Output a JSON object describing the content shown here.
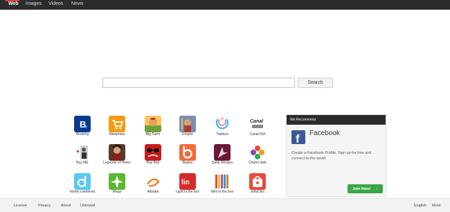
{
  "nav": {
    "tabs": [
      {
        "label": "Web",
        "active": true
      },
      {
        "label": "Images",
        "active": false
      },
      {
        "label": "Videos",
        "active": false
      },
      {
        "label": "News",
        "active": false
      }
    ],
    "accent_color": "#e53935"
  },
  "search": {
    "value": "",
    "button_label": "Search"
  },
  "tiles": [
    {
      "label": "Booking",
      "icon": "booking-icon"
    },
    {
      "label": "Aliexpress",
      "icon": "aliexpress-cart-icon"
    },
    {
      "label": "Big Farm",
      "icon": "big-farm-icon"
    },
    {
      "label": "Empire",
      "icon": "empire-icon"
    },
    {
      "label": "Topface",
      "icon": "topface-icon"
    },
    {
      "label": "Canal Flirt",
      "icon": "canal-flirt-icon",
      "icon_text": "Canal"
    },
    {
      "label": "Buy ME",
      "icon": "buyme-icon"
    },
    {
      "label": "Legends of Honor",
      "icon": "legends-of-honor-icon"
    },
    {
      "label": "Ray Ban",
      "icon": "ray-ban-icon"
    },
    {
      "label": "Badoo",
      "icon": "badoo-icon"
    },
    {
      "label": "Qatar Airways",
      "icon": "qatar-airways-icon"
    },
    {
      "label": "Charm date",
      "icon": "charm-date-icon"
    },
    {
      "label": "hotels combined",
      "icon": "hotels-combined-icon"
    },
    {
      "label": "Wego",
      "icon": "wego-plane-icon"
    },
    {
      "label": "Alibaba",
      "icon": "alibaba-icon"
    },
    {
      "label": "Light in the box",
      "icon": "light-in-the-box-icon",
      "icon_text": "lin"
    },
    {
      "label": "Mini in the box",
      "icon": "mini-in-the-box-icon"
    },
    {
      "label": "JollyChic",
      "icon": "jollychic-icon"
    }
  ],
  "recommend": {
    "header": "We Recommend",
    "title": "Facebook",
    "description": "Create a Facebook Profile. Sign up for free and connect to the world",
    "button_label": "Join Now!",
    "button_color": "#3aa745",
    "brand_color": "#3b5998"
  },
  "footer": {
    "links": [
      "License",
      "Privacy",
      "About",
      "Uninstall"
    ],
    "language": "English",
    "more": "More"
  }
}
